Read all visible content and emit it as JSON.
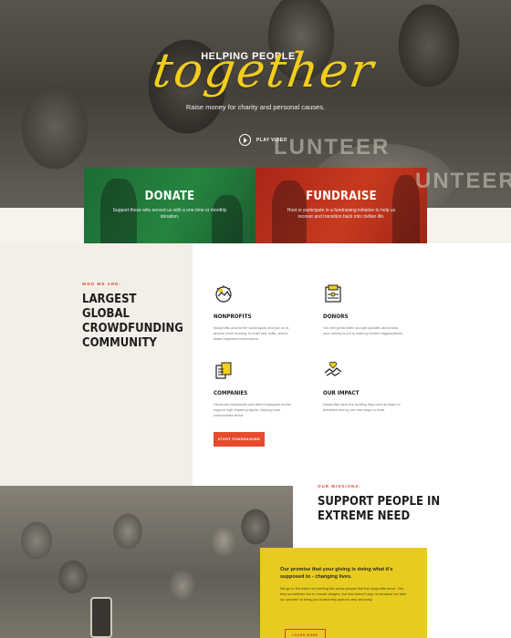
{
  "hero": {
    "kicker": "HELPING PEOPLE",
    "script": "together",
    "subtitle": "Raise money for charity and personal causes.",
    "play_label": "PLAY VIDEO",
    "tee_left": "LUNTEER",
    "tee_right": "UNTEER"
  },
  "cards": {
    "donate": {
      "title": "DONATE",
      "text": "Support those who served us with a one-time or monthly donation."
    },
    "fundraise": {
      "title": "FUNDRAISE",
      "text": "Host or participate in a fundraising initiative to help us recover and transition back into civilian life."
    }
  },
  "about": {
    "kicker": "WHO WE ARE:",
    "title": "LARGEST GLOBAL CROWDFUNDING COMMUNITY",
    "features": [
      {
        "title": "NONPROFITS",
        "text": "Nonprofits around the world apply and join us to access more funding, to build new skills, and to make important connections.",
        "icon": "nonprofit-icon"
      },
      {
        "title": "DONORS",
        "text": "You feel great when you get updates about how your money is put to work by trusted organizations.",
        "icon": "donor-icon"
      },
      {
        "title": "COMPANIES",
        "text": "Generous companies and their employees further support high-impact projects, helping local communities thrive.",
        "icon": "company-icon"
      },
      {
        "title": "OUR IMPACT",
        "text": "Nonprofits have the funding they need to listen to feedback and try out new ways to work.",
        "icon": "impact-icon"
      }
    ],
    "cta": "START FUNDRAISING"
  },
  "mission": {
    "kicker": "OUR MISSIONS:",
    "title": "SUPPORT PEOPLE IN EXTREME NEED",
    "lead": "Our promise that your giving is doing what it's supposed to - changing lives.",
    "text": "We go to the extent of meeting the actual people that the nonprofits serve. Yes, they sometimes live in remote villages, but that doesn't stop us because we take our promise to bring you trustworthy options very seriously.",
    "cta": "LEARN MORE"
  },
  "colors": {
    "accent_yellow": "#e8cb1f",
    "accent_red": "#e64b2e",
    "donate_green": "#25843f",
    "fundraise_red": "#c83a1f"
  }
}
